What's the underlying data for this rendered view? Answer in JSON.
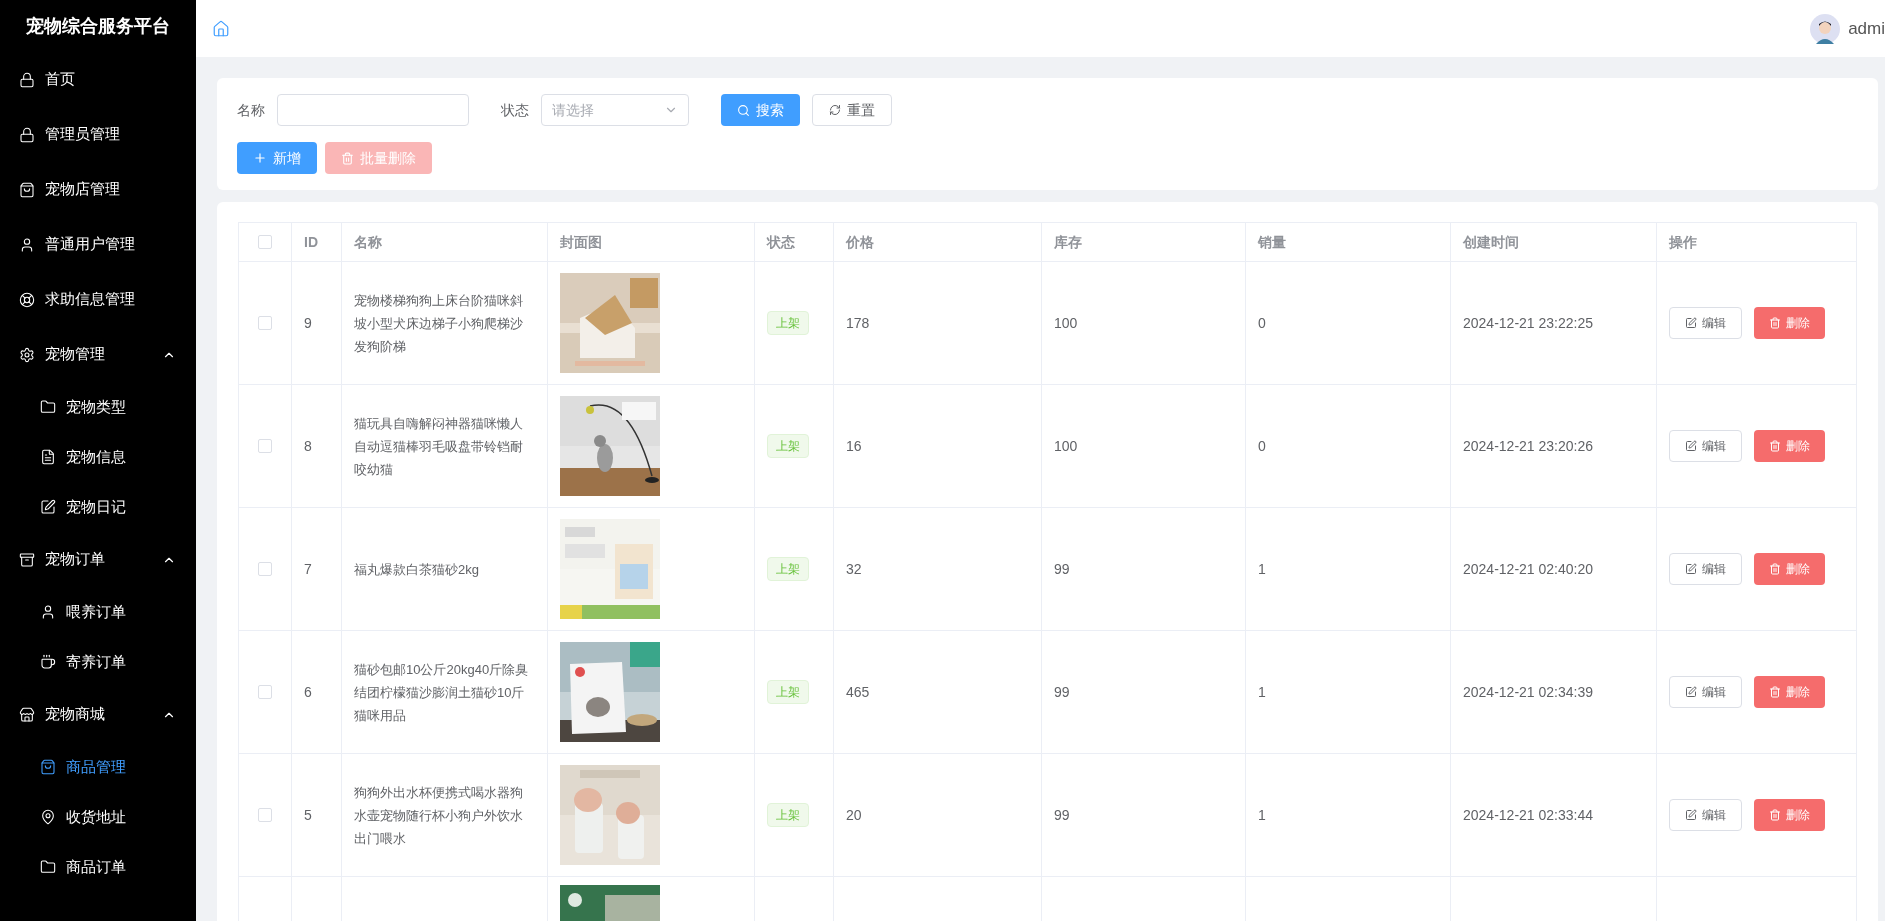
{
  "sidebar": {
    "title": "宠物综合服务平台",
    "items": [
      {
        "label": "首页",
        "selected": false
      },
      {
        "label": "管理员管理",
        "selected": false
      },
      {
        "label": "宠物店管理",
        "selected": false
      },
      {
        "label": "普通用户管理",
        "selected": false
      },
      {
        "label": "求助信息管理",
        "selected": false
      },
      {
        "label": "宠物管理",
        "expanded": true,
        "selected": false,
        "children": [
          {
            "label": "宠物类型",
            "selected": false
          },
          {
            "label": "宠物信息",
            "selected": false
          },
          {
            "label": "宠物日记",
            "selected": false
          }
        ]
      },
      {
        "label": "宠物订单",
        "expanded": true,
        "selected": false,
        "children": [
          {
            "label": "喂养订单",
            "selected": false
          },
          {
            "label": "寄养订单",
            "selected": false
          }
        ]
      },
      {
        "label": "宠物商城",
        "expanded": true,
        "selected": false,
        "children": [
          {
            "label": "商品管理",
            "selected": true
          },
          {
            "label": "收货地址",
            "selected": false
          },
          {
            "label": "商品订单",
            "selected": false
          }
        ]
      }
    ]
  },
  "header": {
    "user": "admi"
  },
  "search": {
    "name_label": "名称",
    "status_label": "状态",
    "status_placeholder": "请选择",
    "search_button": "搜索",
    "reset_button": "重置",
    "add_button": "新增",
    "batch_delete_button": "批量删除",
    "batch_delete_disabled": true
  },
  "table": {
    "select_all_checked": false,
    "columns": [
      "ID",
      "名称",
      "封面图",
      "状态",
      "价格",
      "库存",
      "销量",
      "创建时间",
      "操作"
    ],
    "rows": [
      {
        "id": "9",
        "name": "宠物楼梯狗狗上床台阶猫咪斜坡小型犬床边梯子小狗爬梯沙发狗阶梯",
        "status": "上架",
        "price": "178",
        "stock": "100",
        "sales": "0",
        "created": "2024-12-21 23:22:25",
        "checked": false,
        "edit": "编辑",
        "delete": "删除"
      },
      {
        "id": "8",
        "name": "猫玩具自嗨解闷神器猫咪懒人自动逗猫棒羽毛吸盘带铃铛耐咬幼猫",
        "status": "上架",
        "price": "16",
        "stock": "100",
        "sales": "0",
        "created": "2024-12-21 23:20:26",
        "checked": false,
        "edit": "编辑",
        "delete": "删除"
      },
      {
        "id": "7",
        "name": "福丸爆款白茶猫砂2kg",
        "status": "上架",
        "price": "32",
        "stock": "99",
        "sales": "1",
        "created": "2024-12-21 02:40:20",
        "checked": false,
        "edit": "编辑",
        "delete": "删除"
      },
      {
        "id": "6",
        "name": "猫砂包邮10公斤20kg40斤除臭结团柠檬猫沙膨润土猫砂10斤猫咪用品",
        "status": "上架",
        "price": "465",
        "stock": "99",
        "sales": "1",
        "created": "2024-12-21 02:34:39",
        "checked": false,
        "edit": "编辑",
        "delete": "删除"
      },
      {
        "id": "5",
        "name": "狗狗外出水杯便携式喝水器狗水壶宠物随行杯小狗户外饮水出门喂水",
        "status": "上架",
        "price": "20",
        "stock": "99",
        "sales": "1",
        "created": "2024-12-21 02:33:44",
        "checked": false,
        "edit": "编辑",
        "delete": "删除"
      }
    ]
  }
}
